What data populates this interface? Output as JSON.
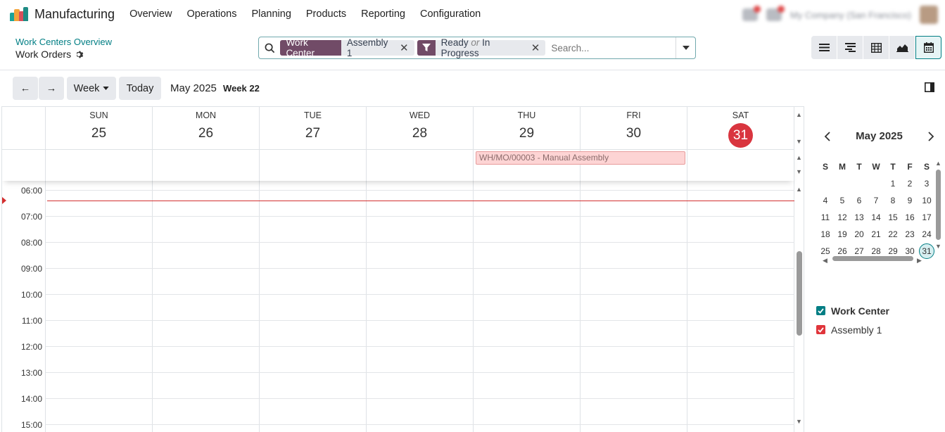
{
  "app": {
    "name": "Manufacturing"
  },
  "menu": [
    "Overview",
    "Operations",
    "Planning",
    "Products",
    "Reporting",
    "Configuration"
  ],
  "user": {
    "company": "My Company (San Francisco)"
  },
  "breadcrumb": {
    "parent": "Work Centers Overview",
    "current": "Work Orders"
  },
  "search": {
    "facet1": {
      "tag": "Work Center",
      "value": "Assembly 1"
    },
    "facet2": {
      "value_a": "Ready",
      "or": "or",
      "value_b": "In Progress"
    },
    "placeholder": "Search..."
  },
  "views": [
    "list",
    "gantt",
    "pivot",
    "graph",
    "calendar"
  ],
  "toolbar": {
    "prev": "←",
    "next": "→",
    "scale": "Week",
    "today": "Today",
    "title": "May 2025",
    "week": "Week 22"
  },
  "days": [
    {
      "name": "SUN",
      "num": "25"
    },
    {
      "name": "MON",
      "num": "26"
    },
    {
      "name": "TUE",
      "num": "27"
    },
    {
      "name": "WED",
      "num": "28"
    },
    {
      "name": "THU",
      "num": "29"
    },
    {
      "name": "FRI",
      "num": "30"
    },
    {
      "name": "SAT",
      "num": "31"
    }
  ],
  "event": {
    "title": "WH/MO/00003 - Manual Assembly"
  },
  "hours": [
    "06:00",
    "07:00",
    "08:00",
    "09:00",
    "10:00",
    "11:00",
    "12:00",
    "13:00",
    "14:00",
    "15:00"
  ],
  "mini_calendar": {
    "title": "May 2025",
    "dow": [
      "S",
      "M",
      "T",
      "W",
      "T",
      "F",
      "S"
    ],
    "weeks": [
      [
        "",
        "",
        "",
        "",
        "1",
        "2",
        "3"
      ],
      [
        "4",
        "5",
        "6",
        "7",
        "8",
        "9",
        "10"
      ],
      [
        "11",
        "12",
        "13",
        "14",
        "15",
        "16",
        "17"
      ],
      [
        "18",
        "19",
        "20",
        "21",
        "22",
        "23",
        "24"
      ],
      [
        "25",
        "26",
        "27",
        "28",
        "29",
        "30",
        "31"
      ]
    ],
    "today": "31"
  },
  "filters": {
    "section": "Work Center",
    "items": [
      "Assembly 1"
    ]
  },
  "colors": {
    "brand": "#714b67",
    "accent": "#017e84",
    "today": "#d9353f",
    "event_bg": "#fdd4d4"
  }
}
